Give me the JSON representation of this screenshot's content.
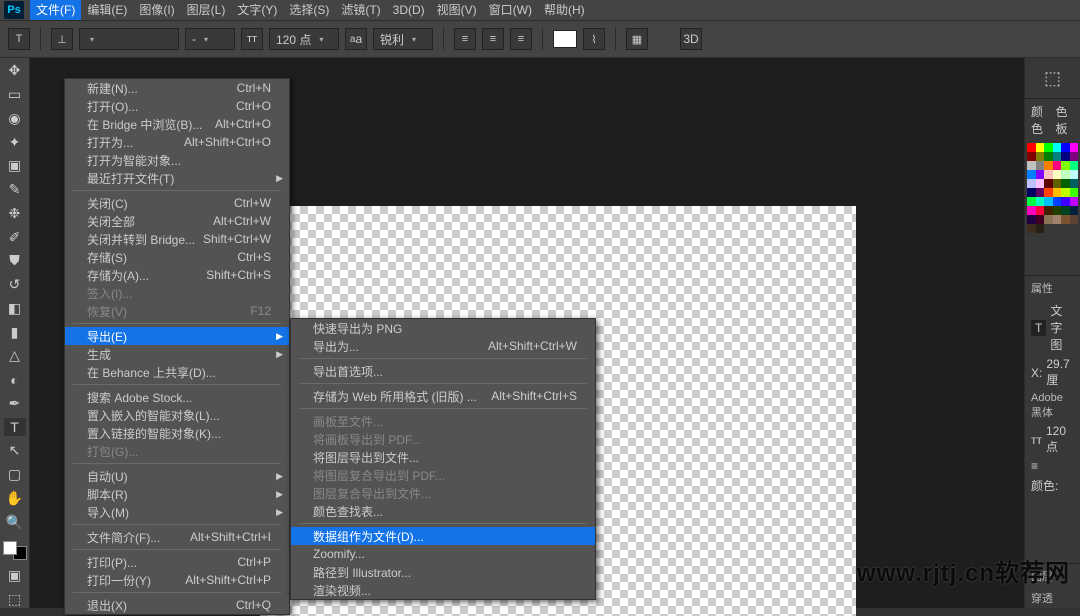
{
  "app": "Ps",
  "menubar": [
    "文件(F)",
    "编辑(E)",
    "图像(I)",
    "图层(L)",
    "文字(Y)",
    "选择(S)",
    "滤镜(T)",
    "3D(D)",
    "视图(V)",
    "窗口(W)",
    "帮助(H)"
  ],
  "options": {
    "font_style": "-",
    "size": "120 点",
    "aa": "锐利",
    "three_d": "3D"
  },
  "file_menu": [
    {
      "l": "新建(N)...",
      "s": "Ctrl+N"
    },
    {
      "l": "打开(O)...",
      "s": "Ctrl+O"
    },
    {
      "l": "在 Bridge 中浏览(B)...",
      "s": "Alt+Ctrl+O"
    },
    {
      "l": "打开为...",
      "s": "Alt+Shift+Ctrl+O"
    },
    {
      "l": "打开为智能对象..."
    },
    {
      "l": "最近打开文件(T)",
      "sub": true
    },
    {
      "sep": true
    },
    {
      "l": "关闭(C)",
      "s": "Ctrl+W"
    },
    {
      "l": "关闭全部",
      "s": "Alt+Ctrl+W"
    },
    {
      "l": "关闭并转到 Bridge...",
      "s": "Shift+Ctrl+W"
    },
    {
      "l": "存储(S)",
      "s": "Ctrl+S"
    },
    {
      "l": "存储为(A)...",
      "s": "Shift+Ctrl+S"
    },
    {
      "l": "签入(I)...",
      "d": true
    },
    {
      "l": "恢复(V)",
      "s": "F12",
      "d": true
    },
    {
      "sep": true
    },
    {
      "l": "导出(E)",
      "sub": true,
      "hi": true
    },
    {
      "l": "生成",
      "sub": true
    },
    {
      "l": "在 Behance 上共享(D)..."
    },
    {
      "sep": true
    },
    {
      "l": "搜索 Adobe Stock..."
    },
    {
      "l": "置入嵌入的智能对象(L)..."
    },
    {
      "l": "置入链接的智能对象(K)..."
    },
    {
      "l": "打包(G)...",
      "d": true
    },
    {
      "sep": true
    },
    {
      "l": "自动(U)",
      "sub": true
    },
    {
      "l": "脚本(R)",
      "sub": true
    },
    {
      "l": "导入(M)",
      "sub": true
    },
    {
      "sep": true
    },
    {
      "l": "文件简介(F)...",
      "s": "Alt+Shift+Ctrl+I"
    },
    {
      "sep": true
    },
    {
      "l": "打印(P)...",
      "s": "Ctrl+P"
    },
    {
      "l": "打印一份(Y)",
      "s": "Alt+Shift+Ctrl+P"
    },
    {
      "sep": true
    },
    {
      "l": "退出(X)",
      "s": "Ctrl+Q"
    }
  ],
  "export_menu": [
    {
      "l": "快速导出为 PNG"
    },
    {
      "l": "导出为...",
      "s": "Alt+Shift+Ctrl+W"
    },
    {
      "sep": true
    },
    {
      "l": "导出首选项..."
    },
    {
      "sep": true
    },
    {
      "l": "存储为 Web 所用格式 (旧版) ...",
      "s": "Alt+Shift+Ctrl+S"
    },
    {
      "sep": true
    },
    {
      "l": "画板至文件...",
      "d": true
    },
    {
      "l": "将画板导出到 PDF...",
      "d": true
    },
    {
      "l": "将图层导出到文件..."
    },
    {
      "l": "将图层复合导出到 PDF...",
      "d": true
    },
    {
      "l": "图层复合导出到文件...",
      "d": true
    },
    {
      "l": "颜色查找表..."
    },
    {
      "sep": true
    },
    {
      "l": "数据组作为文件(D)...",
      "hi": true
    },
    {
      "l": "Zoomify..."
    },
    {
      "l": "路径到 Illustrator..."
    },
    {
      "l": "渲染视频..."
    }
  ],
  "swatch_colors": [
    "#ff0000",
    "#ffff00",
    "#00ff00",
    "#00ffff",
    "#0000ff",
    "#ff00ff",
    "#800000",
    "#808000",
    "#008000",
    "#008080",
    "#000080",
    "#800080",
    "#c0c0c0",
    "#808080",
    "#ff8000",
    "#ff0080",
    "#80ff00",
    "#00ff80",
    "#0080ff",
    "#8000ff",
    "#ffc0c0",
    "#ffffc0",
    "#c0ffc0",
    "#c0ffff",
    "#c0c0ff",
    "#ffc0ff",
    "#600000",
    "#606000",
    "#006000",
    "#006060",
    "#000060",
    "#600060",
    "#ff4000",
    "#ffbf00",
    "#bfff00",
    "#40ff00",
    "#00ff40",
    "#00ffbf",
    "#00bfff",
    "#0040ff",
    "#4000ff",
    "#bf00ff",
    "#ff00bf",
    "#ff0040",
    "#402000",
    "#204000",
    "#004020",
    "#002040",
    "#200040",
    "#400020",
    "#8b7355",
    "#a0826d",
    "#7a5230",
    "#5c4033",
    "#3f2e1f",
    "#262015"
  ],
  "right": {
    "tab1": "颜色",
    "tab1b": "色板",
    "props": "属性",
    "char": "文字图",
    "xlabel": "X:",
    "xval": "29.7 厘",
    "font": "Adobe 黑体",
    "size": "120 点",
    "color_label": "颜色:",
    "layers": "图层",
    "pass": "穿透"
  },
  "watermark": "www.rjtj.cn软荐网"
}
